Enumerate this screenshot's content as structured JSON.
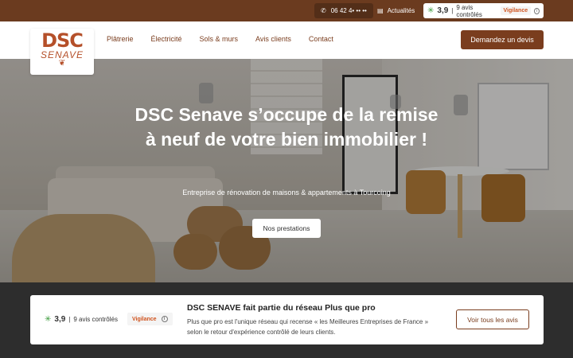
{
  "topbar": {
    "phone": "06 42 4• •• ••",
    "news_label": "Actualités",
    "rating_score": "3,9",
    "rating_count": "9 avis contrôlés",
    "vigilance": "Vigilance"
  },
  "logo": {
    "line1": "DSC",
    "line2": "SENAVE"
  },
  "nav": {
    "items": [
      "Plâtrerie",
      "Électricité",
      "Sols & murs",
      "Avis clients",
      "Contact"
    ],
    "cta": "Demandez un devis"
  },
  "hero": {
    "title": "DSC Senave s’occupe de la remise à neuf de votre bien immobilier !",
    "subtitle": "Entreprise de rénovation de maisons & appartements à Tourcoing",
    "button": "Nos prestations"
  },
  "card": {
    "rating_score": "3,9",
    "rating_count": "9 avis contrôlés",
    "vigilance": "Vigilance",
    "title": "DSC SENAVE fait partie du réseau Plus que pro",
    "text": "Plus que pro est l'unique réseau qui recense « les Meilleures Entreprises de France » selon le retour d'expérience contrôlé de leurs clients.",
    "button": "Voir tous les avis"
  },
  "colors": {
    "brand": "#7a3d1e",
    "topbar": "#6b3b1f",
    "vigilance": "#d0531e",
    "star": "#3a9a3a"
  }
}
